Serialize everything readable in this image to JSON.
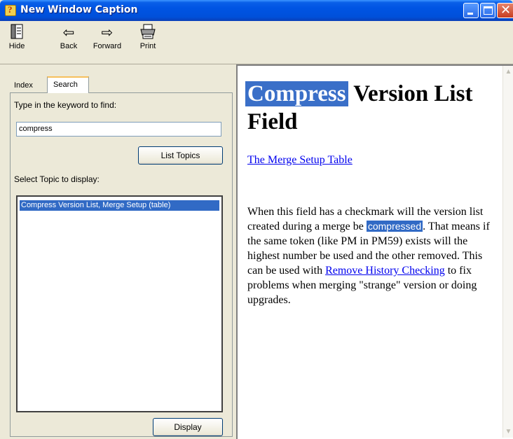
{
  "window": {
    "title": "New Window Caption",
    "controls": [
      "minimize",
      "maximize",
      "close"
    ]
  },
  "toolbar": {
    "buttons": [
      {
        "label": "Hide",
        "icon": "hide-icon"
      },
      {
        "label": "Back",
        "icon": "back-arrow-icon"
      },
      {
        "label": "Forward",
        "icon": "forward-arrow-icon"
      },
      {
        "label": "Print",
        "icon": "printer-icon"
      }
    ]
  },
  "left": {
    "tabs": [
      {
        "label": "Index",
        "active": false
      },
      {
        "label": "Search",
        "active": true
      }
    ],
    "keyword_label": "Type in the keyword to find:",
    "keyword_value": "compress",
    "list_topics_button": "List Topics",
    "select_label": "Select Topic to display:",
    "topics": [
      {
        "label": "Compress Version List, Merge Setup (table)",
        "selected": true
      }
    ],
    "display_button": "Display"
  },
  "right": {
    "heading_highlight": "Compress",
    "heading_rest": " Version List Field",
    "link_merge": "The Merge Setup Table",
    "para_1": "When this field has a checkmark will the version list created during a merge be ",
    "para_highlight": "compressed",
    "para_2": ". That means if the same token (like PM in PM59) exists will the highest number be used and the other removed. This can be used with ",
    "link_remove": "Remove History Checking",
    "para_3": " to fix problems when merging \"strange\" version or doing upgrades."
  },
  "colors": {
    "titlebar": "#0054e3",
    "selection": "#316ac5",
    "link": "#0000ee",
    "face": "#ece9d8"
  }
}
